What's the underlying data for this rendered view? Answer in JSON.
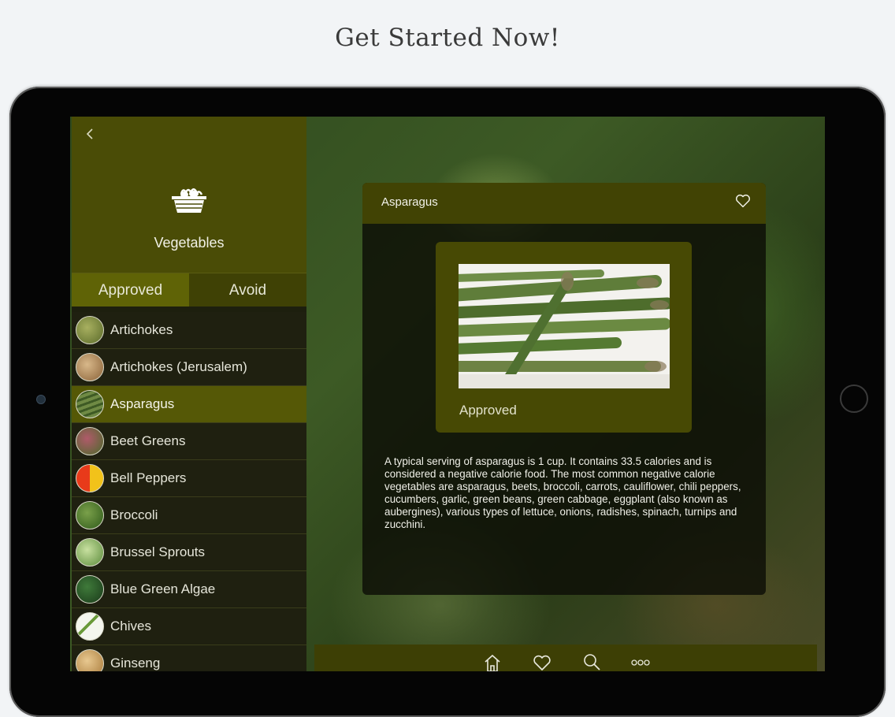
{
  "headline": "Get Started Now!",
  "sidebar": {
    "title": "Vegetables",
    "back_icon": "chevron-left-icon",
    "category_icon": "basket-icon",
    "tabs": [
      {
        "label": "Approved",
        "active": true
      },
      {
        "label": "Avoid",
        "active": false
      }
    ],
    "items": [
      {
        "label": "Artichokes",
        "color": "#7f8a3a"
      },
      {
        "label": "Artichokes (Jerusalem)",
        "color": "#a07a4a"
      },
      {
        "label": "Asparagus",
        "color": "#5f7a3a",
        "selected": true
      },
      {
        "label": "Beet Greens",
        "color": "#7a3a4a"
      },
      {
        "label": "Bell Peppers",
        "color": "#d84a1a"
      },
      {
        "label": "Broccoli",
        "color": "#4f7a2a"
      },
      {
        "label": "Brussel Sprouts",
        "color": "#7aa04a"
      },
      {
        "label": "Blue Green Algae",
        "color": "#2f5a2a"
      },
      {
        "label": "Chives",
        "color": "#e8eee0"
      },
      {
        "label": "Ginseng",
        "color": "#c89a5a"
      }
    ]
  },
  "detail": {
    "title": "Asparagus",
    "status": "Approved",
    "description": "A typical serving of asparagus is 1 cup. It contains 33.5 calories and is considered a negative calorie food. The most common negative calorie vegetables are asparagus, beets, broccoli, carrots, cauliflower, chili peppers, cucumbers, garlic, green beans, green cabbage, eggplant (also known as aubergines), various types of lettuce, onions, radishes, spinach, turnips and zucchini."
  },
  "toolbar": {
    "icons": [
      "home-icon",
      "heart-icon",
      "search-icon",
      "more-icon"
    ]
  }
}
